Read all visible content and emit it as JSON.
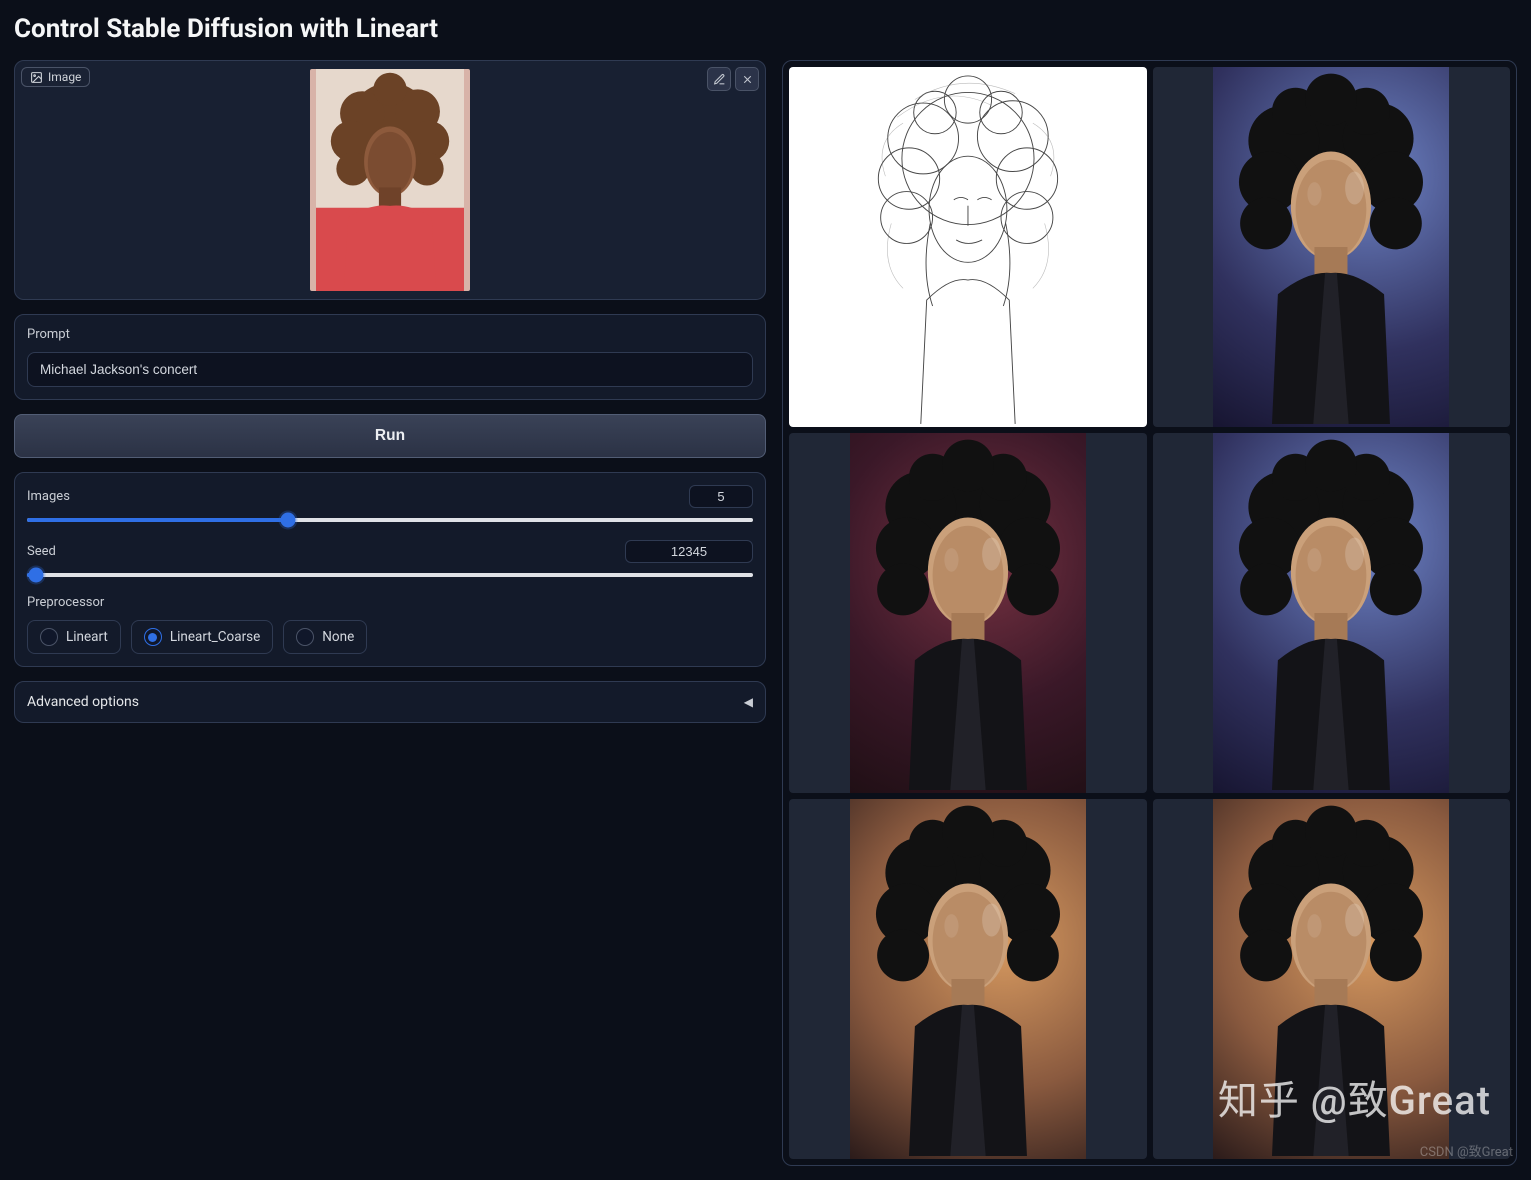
{
  "title": "Control Stable Diffusion with Lineart",
  "image_upload": {
    "label": "Image"
  },
  "prompt": {
    "label": "Prompt",
    "value": "Michael Jackson's concert"
  },
  "run_button": "Run",
  "sliders": {
    "images": {
      "label": "Images",
      "value": 5,
      "min": 1,
      "max": 12,
      "percent": 36
    },
    "seed": {
      "label": "Seed",
      "value": 12345,
      "min": 0,
      "max": 1000000,
      "percent": 1.2
    }
  },
  "preprocessor": {
    "label": "Preprocessor",
    "options": [
      "Lineart",
      "Lineart_Coarse",
      "None"
    ],
    "selected": "Lineart_Coarse"
  },
  "advanced": {
    "label": "Advanced options",
    "expanded": false
  },
  "gallery": [
    {
      "kind": "lineart-sketch"
    },
    {
      "kind": "portrait-blue-red"
    },
    {
      "kind": "portrait-red"
    },
    {
      "kind": "portrait-blue"
    },
    {
      "kind": "portrait-warm-dark"
    },
    {
      "kind": "portrait-warm-gold"
    }
  ],
  "watermarks": {
    "main": "知乎 @致Great",
    "small": "CSDN @致Great"
  }
}
